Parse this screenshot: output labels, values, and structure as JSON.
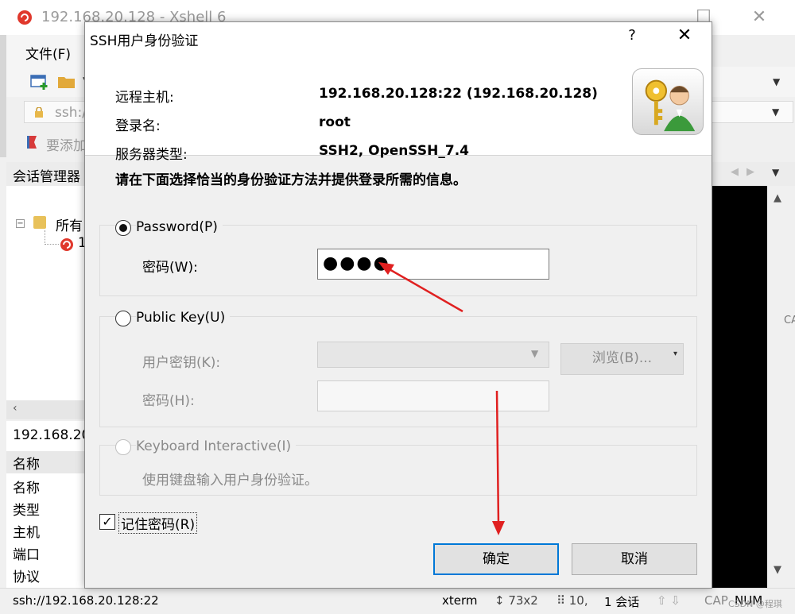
{
  "background_window": {
    "title": "192.168.20.128 - Xshell 6",
    "max_glyph": "☐",
    "close_glyph": "✕",
    "menu_file": "文件(F)",
    "right_glyph": "手",
    "address_text": "ssh://",
    "links_text": "要添加",
    "session_manager": "会话管理器",
    "tree_toggle": "−",
    "tree_root": "所有",
    "tree_child": "1",
    "props_host": "192.168.20",
    "props_header": "名称",
    "props_rows": [
      "名称",
      "类型",
      "主机",
      "端口",
      "协议"
    ],
    "side_strip": "CA",
    "statusbar": {
      "address": "ssh://192.168.20.128:22",
      "term": "xterm",
      "size": "↕ 73x2",
      "position": "⠿ 10,",
      "sessions": "1 会话",
      "arrows": "⇧ ⇩",
      "cap": "CAP",
      "num": "NUM"
    },
    "watermark": "CSDN @程琪"
  },
  "dialog": {
    "title": "SSH用户身份验证",
    "help_glyph": "?",
    "close_glyph": "✕",
    "info": {
      "host_label": "远程主机:",
      "host_value": "192.168.20.128:22 (192.168.20.128)",
      "user_label": "登录名:",
      "user_value": "root",
      "server_label": "服务器类型:",
      "server_value": "SSH2, OpenSSH_7.4"
    },
    "instruction": "请在下面选择恰当的身份验证方法并提供登录所需的信息。",
    "password_method": {
      "label": "Password(P)",
      "selected": true,
      "field_label": "密码(W):",
      "value": "●●●●"
    },
    "publickey_method": {
      "label": "Public Key(U)",
      "selected": false,
      "key_label": "用户密钥(K):",
      "browse_label": "浏览(B)...",
      "passphrase_label": "密码(H):"
    },
    "keyboard_method": {
      "label": "Keyboard Interactive(I)",
      "selected": false,
      "description": "使用键盘输入用户身份验证。"
    },
    "remember_password": {
      "label": "记住密码(R)",
      "checked": true,
      "check_glyph": "✓"
    },
    "ok_label": "确定",
    "cancel_label": "取消"
  },
  "colors": {
    "annotation_arrow": "#e02020",
    "ok_focus": "#0078d7"
  }
}
